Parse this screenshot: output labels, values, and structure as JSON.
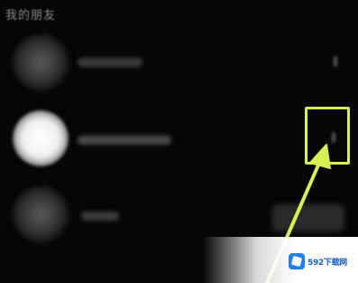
{
  "section": {
    "title": "我的朋友"
  },
  "friends": [
    {
      "avatar_state": "dim"
    },
    {
      "avatar_state": "bright"
    },
    {
      "avatar_state": "dim"
    }
  ],
  "annotation": {
    "color": "#d9ef54",
    "icon": "arrow-up-right-icon"
  },
  "watermark": {
    "text": "592下载网",
    "logo_color": "#1f7ff0"
  }
}
